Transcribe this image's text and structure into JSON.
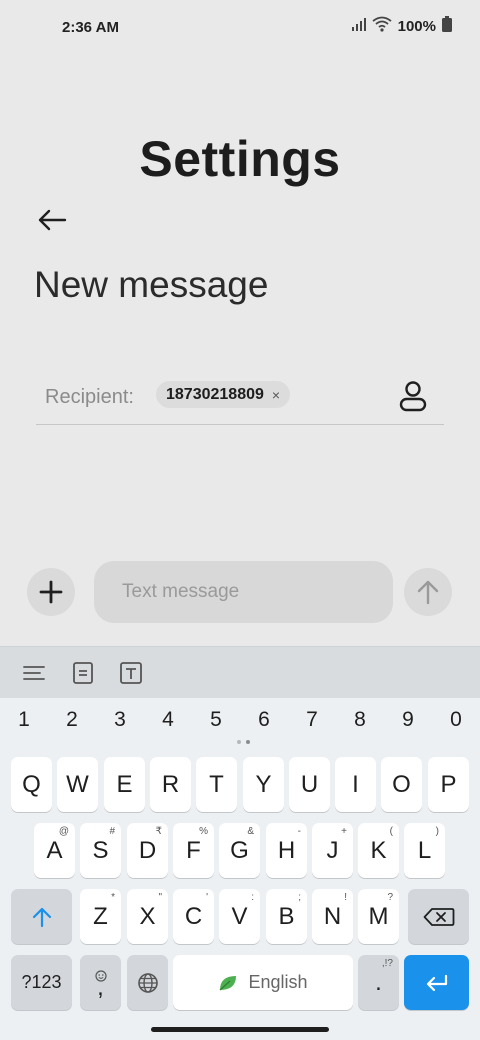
{
  "status_bar": {
    "time": "2:36 AM",
    "battery": "100%"
  },
  "header": {
    "title": "Settings"
  },
  "compose": {
    "title": "New message",
    "recipient_label": "Recipient:",
    "recipient_chip": "18730218809",
    "chip_close": "×",
    "message_placeholder": "Text message"
  },
  "keyboard": {
    "numbers": [
      "1",
      "2",
      "3",
      "4",
      "5",
      "6",
      "7",
      "8",
      "9",
      "0"
    ],
    "row1": [
      "Q",
      "W",
      "E",
      "R",
      "T",
      "Y",
      "U",
      "I",
      "O",
      "P"
    ],
    "row2": [
      {
        "key": "A",
        "hint": "@"
      },
      {
        "key": "S",
        "hint": "#"
      },
      {
        "key": "D",
        "hint": "₹"
      },
      {
        "key": "F",
        "hint": "%"
      },
      {
        "key": "G",
        "hint": "&"
      },
      {
        "key": "H",
        "hint": "-"
      },
      {
        "key": "J",
        "hint": "+"
      },
      {
        "key": "K",
        "hint": "("
      },
      {
        "key": "L",
        "hint": ")"
      }
    ],
    "row3": [
      {
        "key": "Z",
        "hint": "*"
      },
      {
        "key": "X",
        "hint": "\""
      },
      {
        "key": "C",
        "hint": "'"
      },
      {
        "key": "V",
        "hint": ":"
      },
      {
        "key": "B",
        "hint": ";"
      },
      {
        "key": "N",
        "hint": "!"
      },
      {
        "key": "M",
        "hint": "?"
      }
    ],
    "symbols_label": "?123",
    "comma": ",",
    "space_label": "English",
    "period": ".",
    "period_hint": ",!?"
  },
  "colors": {
    "accent": "#1a91ea",
    "background": "#e9e9e9",
    "keyboard_bg": "#edf0f2"
  }
}
